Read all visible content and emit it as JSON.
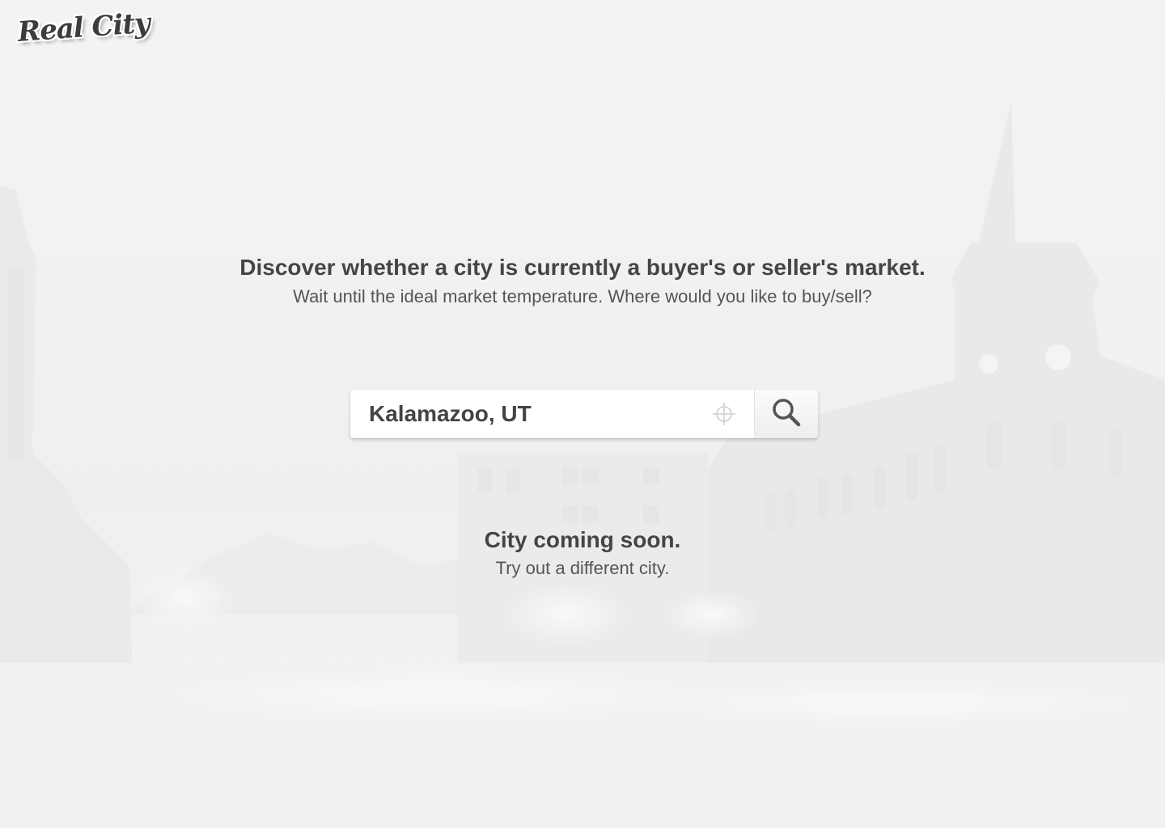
{
  "brand": {
    "logo_text": "Real City"
  },
  "hero": {
    "headline": "Discover whether a city is currently a buyer's or seller's market.",
    "subline": "Wait until the ideal market temperature. Where would you like to buy/sell?"
  },
  "search": {
    "value": "Kalamazoo, UT",
    "locate_icon": "crosshair-icon",
    "search_icon": "magnifier-icon"
  },
  "status": {
    "title": "City coming soon.",
    "subtitle": "Try out a different city."
  },
  "colors": {
    "background": "#f1f1f1",
    "text": "#454545"
  }
}
